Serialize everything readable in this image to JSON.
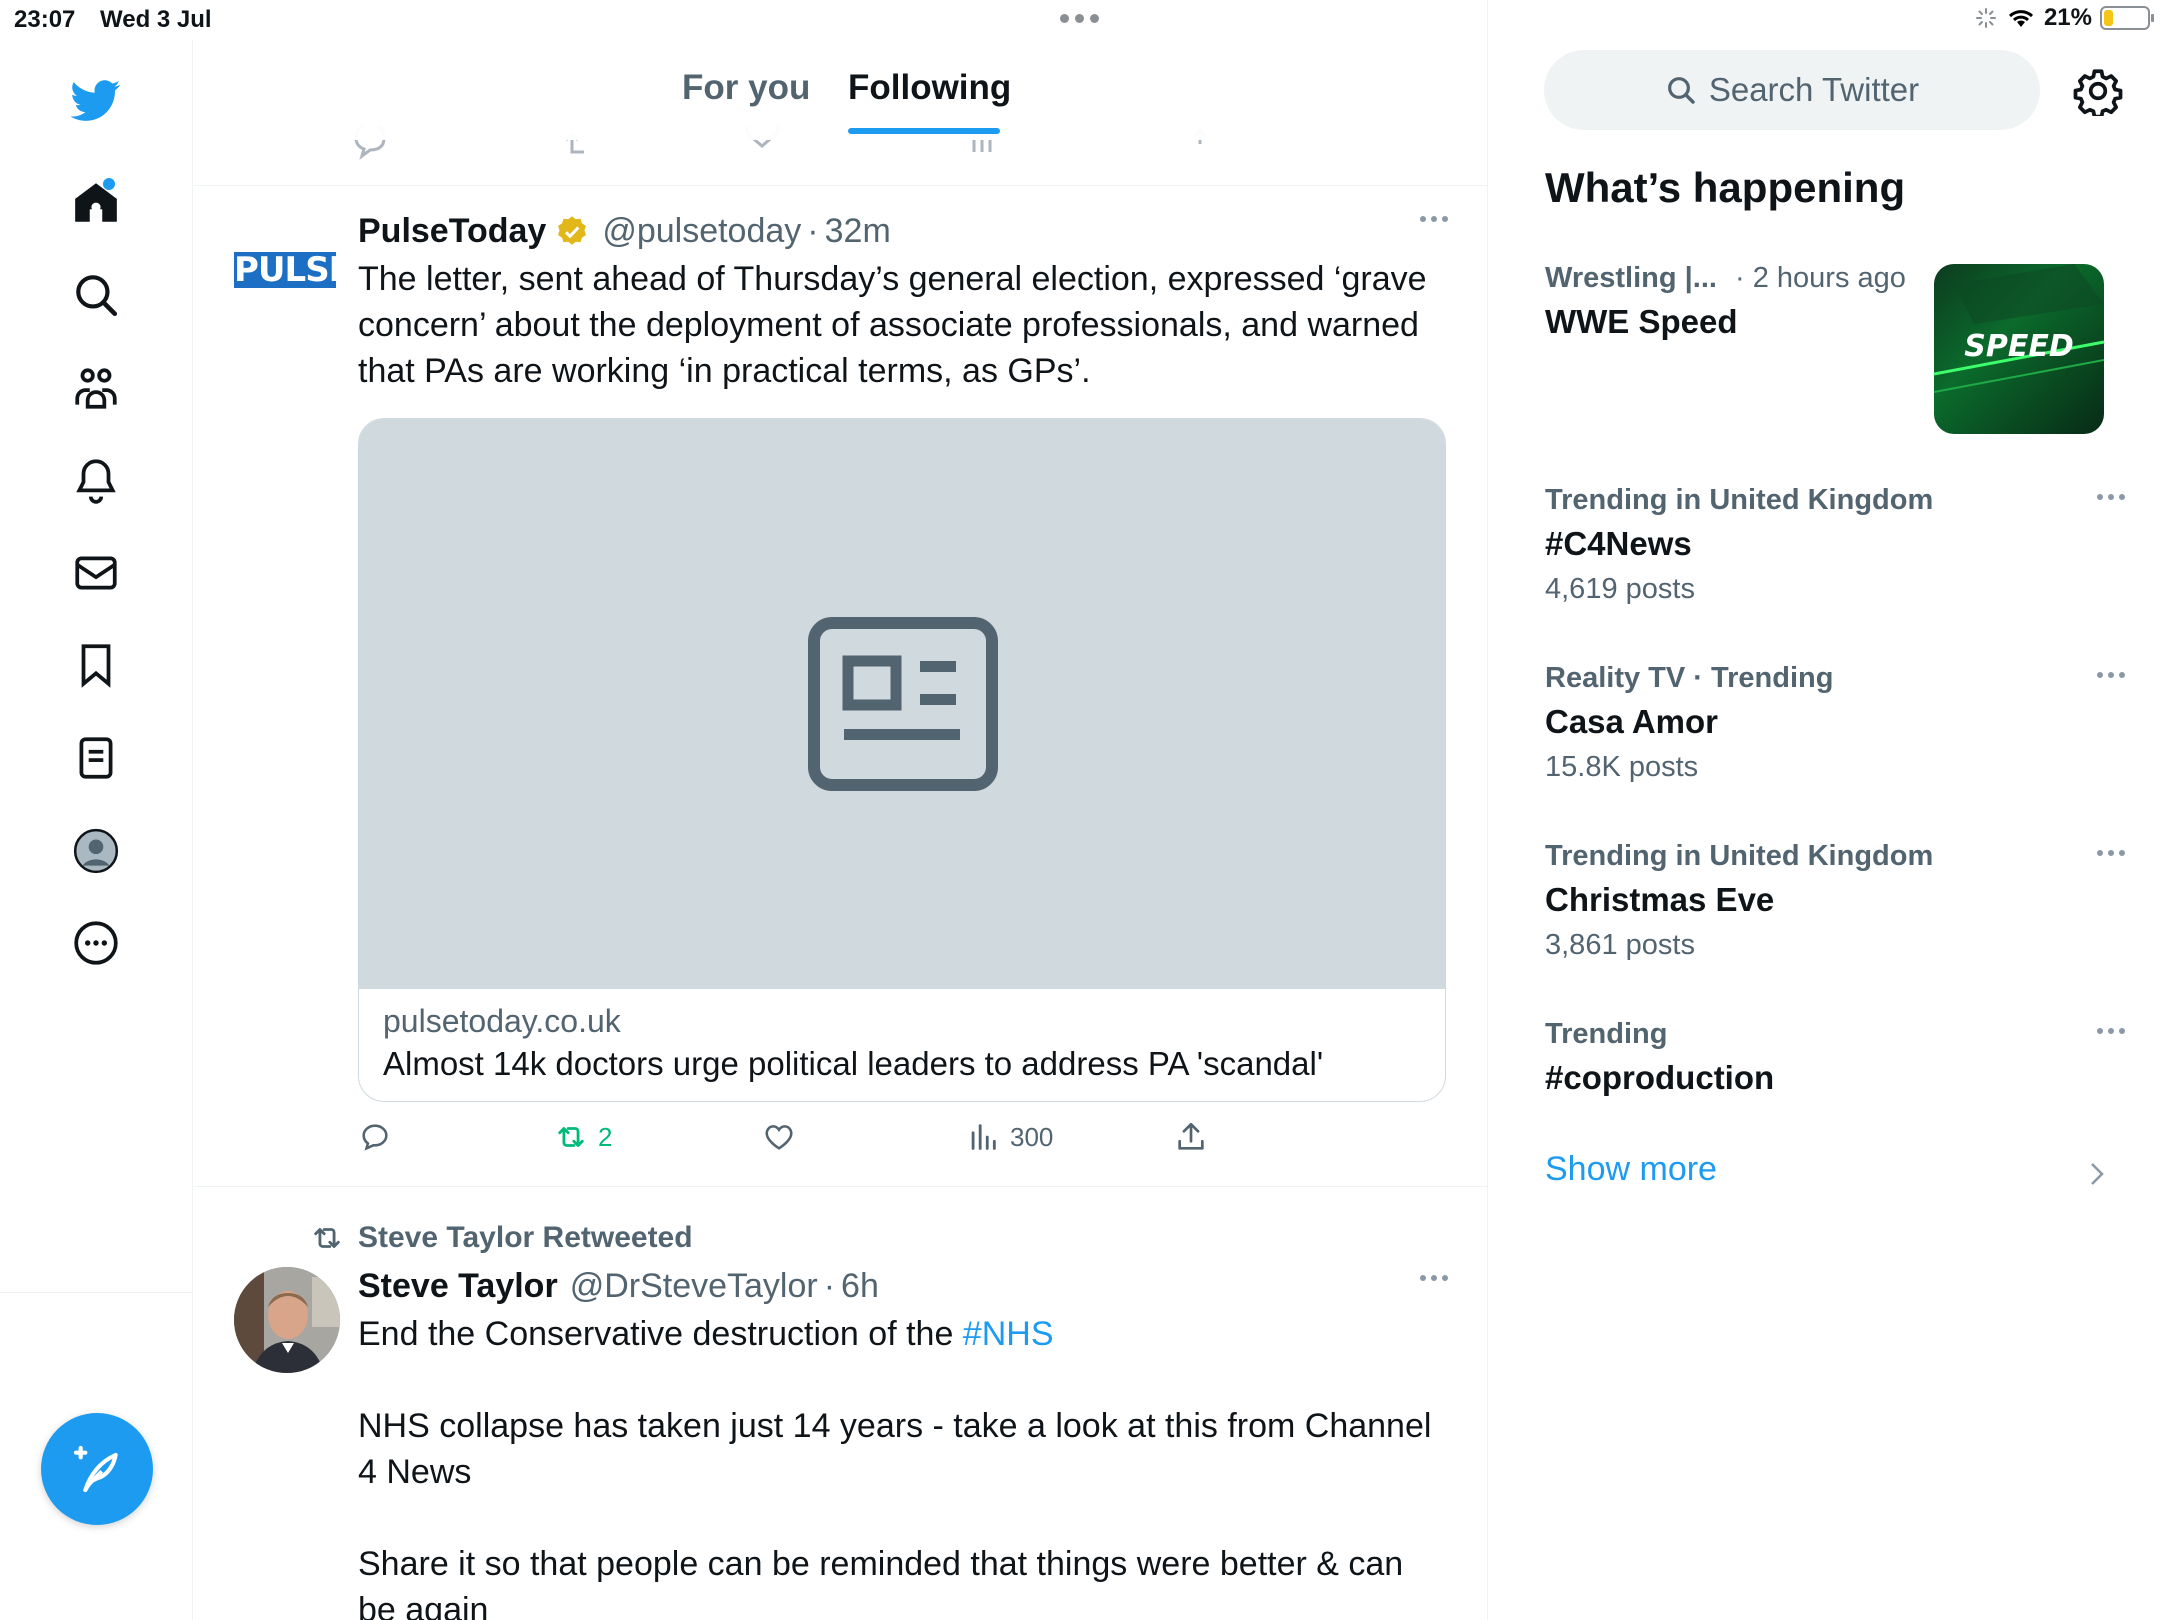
{
  "status_bar": {
    "time": "23:07",
    "date": "Wed 3 Jul",
    "battery": "21%",
    "battery_level": 0.21
  },
  "nav": {
    "items": [
      "twitter-logo",
      "home",
      "explore",
      "communities",
      "notifications",
      "messages",
      "bookmarks",
      "lists",
      "profile",
      "more"
    ]
  },
  "tabs": {
    "for_you": "For you",
    "following": "Following"
  },
  "tweets": [
    {
      "avatar_text": "PULSE",
      "name": "PulseToday",
      "handle": "@pulsetoday",
      "time": "32m",
      "text": "The letter, sent ahead of Thursday’s general election, expressed ‘grave concern’ about the deployment of associate professionals, and warned that PAs are working ‘in practical terms, as GPs’.",
      "card": {
        "domain": "pulsetoday.co.uk",
        "title": "Almost 14k doctors urge political leaders to address PA 'scandal'"
      },
      "stats": {
        "replies": "",
        "retweets": "2",
        "likes": "",
        "views": "300"
      }
    },
    {
      "retweeted_by": "Steve Taylor Retweeted",
      "name": "Steve Taylor",
      "handle": "@DrSteveTaylor",
      "time": "6h",
      "text_prefix": "End the Conservative destruction of the ",
      "hashtag": "#NHS",
      "para2": "NHS collapse has taken just 14 years - take a look at this from Channel 4 News",
      "para3": "Share it so that people can be reminded that things were better & can be again"
    }
  ],
  "sidebar": {
    "search_placeholder": "Search Twitter",
    "title": "What’s happening",
    "trends": [
      {
        "category": "Wrestling |...",
        "time": "· 2 hours ago",
        "name": "WWE Speed",
        "image_text": "SPEED"
      },
      {
        "category": "Trending in United Kingdom",
        "name": "#C4News",
        "count": "4,619 posts"
      },
      {
        "category": "Reality TV · Trending",
        "name": "Casa Amor",
        "count": "15.8K posts"
      },
      {
        "category": "Trending in United Kingdom",
        "name": "Christmas Eve",
        "count": "3,861 posts"
      },
      {
        "category": "Trending",
        "name": "#coproduction",
        "count": ""
      }
    ],
    "show_more": "Show more"
  },
  "colors": {
    "accent": "#1d9bf0",
    "text": "#0f1419",
    "muted": "#536471",
    "retweet_green": "#00ba7c"
  }
}
